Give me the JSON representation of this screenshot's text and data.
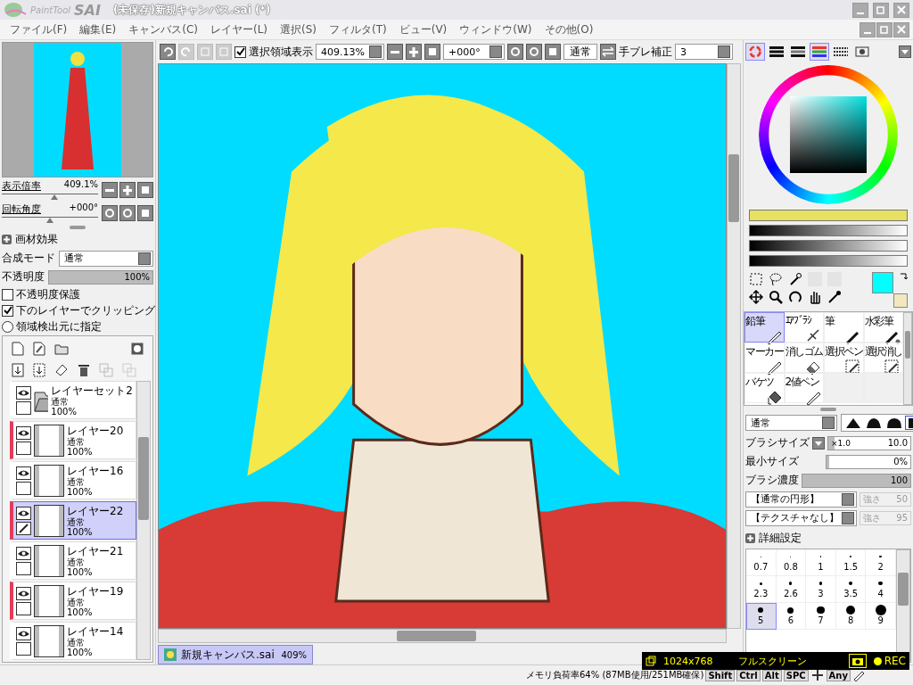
{
  "title_bar": {
    "logo_small": "PaintTool",
    "logo_big": "SAI",
    "title": "(未保存)新規キャンバス.sai (*)"
  },
  "menu": [
    "ファイル(F)",
    "編集(E)",
    "キャンバス(C)",
    "レイヤー(L)",
    "選択(S)",
    "フィルタ(T)",
    "ビュー(V)",
    "ウィンドウ(W)",
    "その他(O)"
  ],
  "toolbar": {
    "selection_display": {
      "label": "選択領域表示",
      "checked": true
    },
    "zoom": "409.13%",
    "rotation": "+000°",
    "blend": "通常",
    "stabilizer_label": "手ブレ補正",
    "stabilizer": "3"
  },
  "navigator": {
    "zoom": {
      "label": "表示倍率",
      "value": "409.1%",
      "level": 0.55
    },
    "rotation": {
      "label": "回転角度",
      "value": "+000°",
      "level": 0.5
    }
  },
  "layer_panel": {
    "effects_label": "画材効果",
    "blend_label": "合成モード",
    "blend": "通常",
    "opacity": {
      "label": "不透明度",
      "value": "100%",
      "level": 1
    },
    "options": [
      {
        "kind": "checkbox",
        "label": "不透明度保護",
        "checked": false
      },
      {
        "kind": "checkbox",
        "label": "下のレイヤーでクリッピング",
        "checked": true
      },
      {
        "kind": "radio",
        "label": "領域検出元に指定",
        "checked": false
      }
    ],
    "layers": [
      {
        "kind": "folder",
        "name": "レイヤーセット2",
        "mode": "通常",
        "opacity": "100%",
        "clipped": false,
        "selected": false
      },
      {
        "kind": "layer",
        "name": "レイヤー20",
        "mode": "通常",
        "opacity": "100%",
        "clipped": true,
        "selected": false
      },
      {
        "kind": "layer",
        "name": "レイヤー16",
        "mode": "通常",
        "opacity": "100%",
        "clipped": false,
        "selected": false
      },
      {
        "kind": "layer",
        "name": "レイヤー22",
        "mode": "通常",
        "opacity": "100%",
        "clipped": true,
        "selected": true
      },
      {
        "kind": "layer",
        "name": "レイヤー21",
        "mode": "通常",
        "opacity": "100%",
        "clipped": false,
        "selected": false
      },
      {
        "kind": "layer",
        "name": "レイヤー19",
        "mode": "通常",
        "opacity": "100%",
        "clipped": true,
        "selected": false
      },
      {
        "kind": "layer",
        "name": "レイヤー14",
        "mode": "通常",
        "opacity": "100%",
        "clipped": false,
        "selected": false
      }
    ]
  },
  "color_tabs": [
    {
      "kind": "wheel",
      "selected": true
    },
    {
      "kind": "rgb",
      "selected": false
    },
    {
      "kind": "hsv",
      "selected": false
    },
    {
      "kind": "swatch",
      "selected": true
    },
    {
      "kind": "palette",
      "selected": false
    },
    {
      "kind": "scratch",
      "selected": false
    }
  ],
  "swatches": [
    {
      "color": "#00ffff"
    },
    {
      "color": "#f2e8c0"
    }
  ],
  "tools": [
    {
      "label": "鉛筆",
      "kind": "pencil",
      "selected": true
    },
    {
      "label": "ｴｱﾌﾞﾗｼ",
      "kind": "airbrush",
      "selected": false
    },
    {
      "label": "筆",
      "kind": "brush",
      "selected": false
    },
    {
      "label": "水彩筆",
      "kind": "watercolor",
      "selected": false
    },
    {
      "label": "マーカー",
      "kind": "pencil",
      "selected": false
    },
    {
      "label": "消しゴム",
      "kind": "eraser",
      "selected": false
    },
    {
      "label": "選択ペン",
      "kind": "selpen",
      "selected": false
    },
    {
      "label": "選択消し",
      "kind": "selerase",
      "selected": false
    },
    {
      "label": "バケツ",
      "kind": "bucket",
      "selected": false
    },
    {
      "label": "2値ペン",
      "kind": "pencil",
      "selected": false
    }
  ],
  "brush": {
    "mode": "通常",
    "shapes": [
      {
        "selected": false
      },
      {
        "selected": false
      },
      {
        "selected": false
      },
      {
        "selected": true
      }
    ],
    "size": {
      "label": "ブラシサイズ",
      "multiplier": "×1.0",
      "value": "10.0",
      "level": 0.08
    },
    "min_size": {
      "label": "最小サイズ",
      "value": "0%",
      "level": 0
    },
    "density": {
      "label": "ブラシ濃度",
      "value": "100",
      "level": 1
    },
    "shape": {
      "value": "【通常の円形】",
      "strength_label": "強さ",
      "strength": "50"
    },
    "texture": {
      "value": "【テクスチャなし】",
      "strength_label": "強さ",
      "strength": "95"
    },
    "advanced_label": "詳細設定",
    "sizes": [
      {
        "label": "0.7",
        "selected": false
      },
      {
        "label": "0.8",
        "selected": false
      },
      {
        "label": "1",
        "selected": false
      },
      {
        "label": "1.5",
        "selected": false
      },
      {
        "label": "2",
        "selected": false
      },
      {
        "label": "2.3",
        "selected": false
      },
      {
        "label": "2.6",
        "selected": false
      },
      {
        "label": "3",
        "selected": false
      },
      {
        "label": "3.5",
        "selected": false
      },
      {
        "label": "4",
        "selected": false
      },
      {
        "label": "5",
        "selected": true
      },
      {
        "label": "6",
        "selected": false
      },
      {
        "label": "7",
        "selected": false
      },
      {
        "label": "8",
        "selected": false
      },
      {
        "label": "9",
        "selected": false
      }
    ]
  },
  "canvas_tab": {
    "name": "新規キャンバス.sai",
    "zoom": "409%",
    "selected": true
  },
  "status_bar": {
    "memory": "メモリ負荷率64% (87MB使用/251MB確保)",
    "keys": [
      "Shift",
      "Ctrl",
      "Alt",
      "SPC"
    ],
    "any": "Any"
  },
  "recorder": {
    "size": "1024x768",
    "mode": "フルスクリーン",
    "rec": "REC"
  }
}
